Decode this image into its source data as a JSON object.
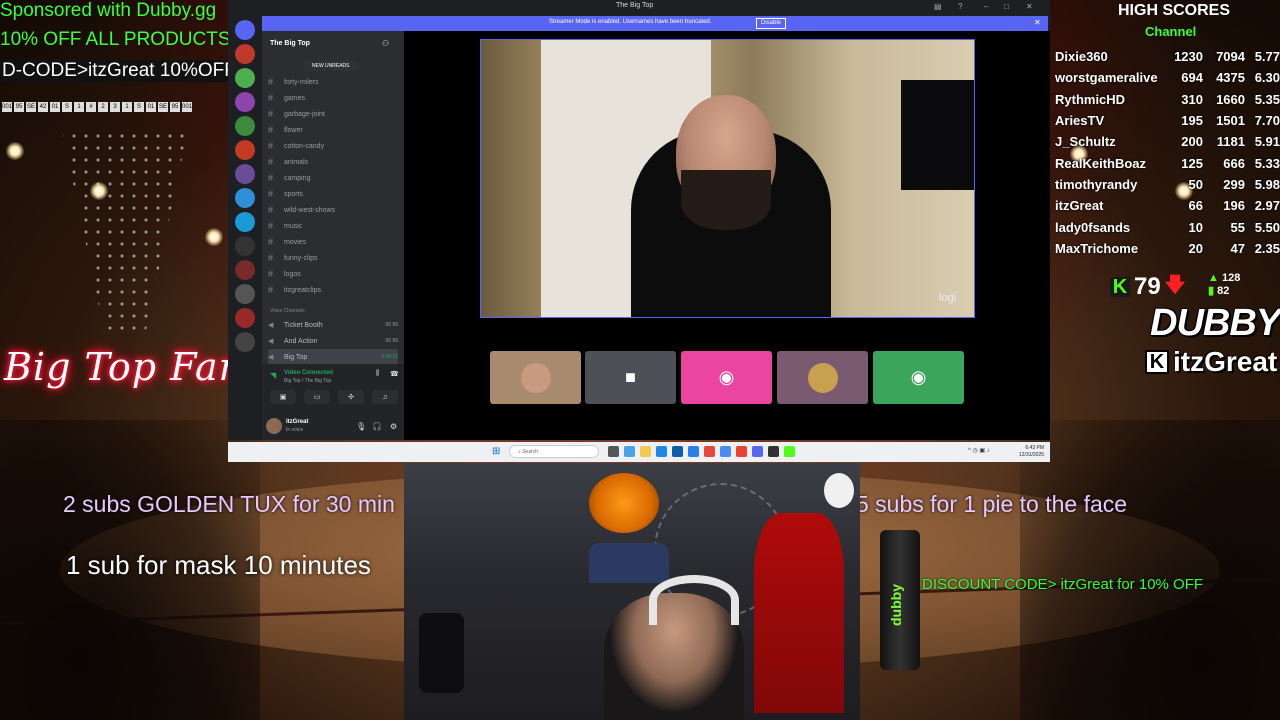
{
  "overlay": {
    "sponsor_line1": "Sponsored with Dubby.gg",
    "sponsor_line2": "10% OFF ALL PRODUCTS",
    "sponsor_line3": "D-CODE>itzGreat 10%OFF.",
    "strip": [
      "001",
      "95",
      "SE",
      "42",
      "01",
      "S",
      "1",
      "#",
      "2",
      "3",
      "1",
      "S",
      "01",
      "SE",
      "95",
      "001"
    ],
    "big_top_fam": "Big Top Fam",
    "incentive_tux": "2 subs GOLDEN TUX for 30 min",
    "incentive_mask": "1 sub for mask 10 minutes",
    "incentive_pie": "5 subs for 1 pie to the face",
    "discount_code": "DISCOUNT CODE> itzGreat for 10% OFF",
    "bottle_label": "dubby"
  },
  "high_scores": {
    "title": "HIGH SCORES",
    "subtitle": "Channel",
    "rows": [
      {
        "name": "Dixie360",
        "a": "1230",
        "b": "7094",
        "c": "5.77"
      },
      {
        "name": "worstgameralive",
        "a": "694",
        "b": "4375",
        "c": "6.30"
      },
      {
        "name": "RythmicHD",
        "a": "310",
        "b": "1660",
        "c": "5.35"
      },
      {
        "name": "AriesTV",
        "a": "195",
        "b": "1501",
        "c": "7.70"
      },
      {
        "name": "J_Schultz",
        "a": "200",
        "b": "1181",
        "c": "5.91"
      },
      {
        "name": "RealKeithBoaz",
        "a": "125",
        "b": "666",
        "c": "5.33"
      },
      {
        "name": "timothyrandy",
        "a": "50",
        "b": "299",
        "c": "5.98"
      },
      {
        "name": "itzGreat",
        "a": "66",
        "b": "196",
        "c": "2.97"
      },
      {
        "name": "lady0fsands",
        "a": "10",
        "b": "55",
        "c": "5.50"
      },
      {
        "name": "MaxTrichome",
        "a": "20",
        "b": "47",
        "c": "2.35"
      }
    ]
  },
  "kick": {
    "logo": "K",
    "count": "79",
    "arrow": "🡇",
    "stat_top": "128",
    "stat_bottom": "82"
  },
  "brand": {
    "dubby": "DUBBY",
    "channel_name": "itzGreat",
    "kick_logo": "K"
  },
  "discord": {
    "window_title": "The Big Top",
    "banner_text": "Streamer Mode is enabled. Usernames have been truncated.",
    "banner_button": "Disable",
    "server_name": "The Big Top",
    "new_unreads": "NEW UNREADS",
    "channels": [
      "forty-milers",
      "games",
      "garbage-joint",
      "flower",
      "cotton-candy",
      "animals",
      "camping",
      "sports",
      "wild-west-shows",
      "music",
      "movies",
      "funny-clips",
      "logos",
      "itzgreatclips"
    ],
    "voice_header": "Voice Channels",
    "voice_channels": [
      {
        "name": "Ticket Booth",
        "time": "00 99"
      },
      {
        "name": "And Action",
        "time": "00 99"
      },
      {
        "name": "Big Top",
        "time": "5:56:22"
      }
    ],
    "vc_status": "Video Connected",
    "vc_sub": "Big Top / The Big Top",
    "user_name": "itzGreat",
    "user_status": "In voice",
    "cam_logo": "logi",
    "tile_icons": [
      "avatar",
      "camera",
      "discord",
      "avatar",
      "discord"
    ]
  },
  "taskbar": {
    "search_placeholder": "Search",
    "time": "6:43 PM",
    "date": "12/31/2025"
  }
}
